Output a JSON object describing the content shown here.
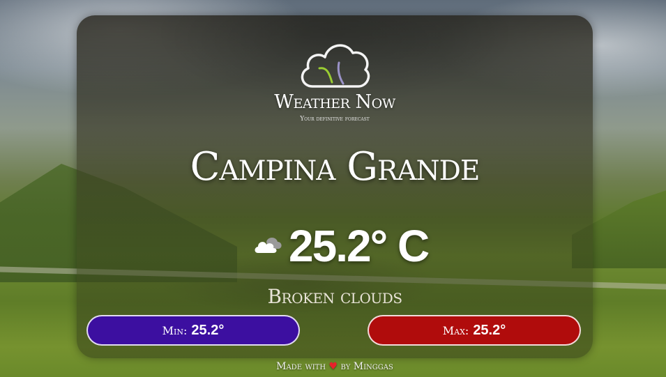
{
  "app": {
    "name": "Weather Now",
    "tagline": "Your definitive forecast"
  },
  "weather": {
    "city": "Campina Grande",
    "temperature": "25.2° C",
    "description": "Broken clouds",
    "icon": "broken-clouds-icon"
  },
  "range": {
    "min_label": "Min:",
    "min_value": "25.2°",
    "max_label": "Max:",
    "max_value": "25.2°"
  },
  "footer": {
    "prefix": "Made with",
    "heart": "♥",
    "suffix": "by Minggas"
  },
  "colors": {
    "min_pill": "#3c0fa0",
    "max_pill": "#b00c0c"
  }
}
